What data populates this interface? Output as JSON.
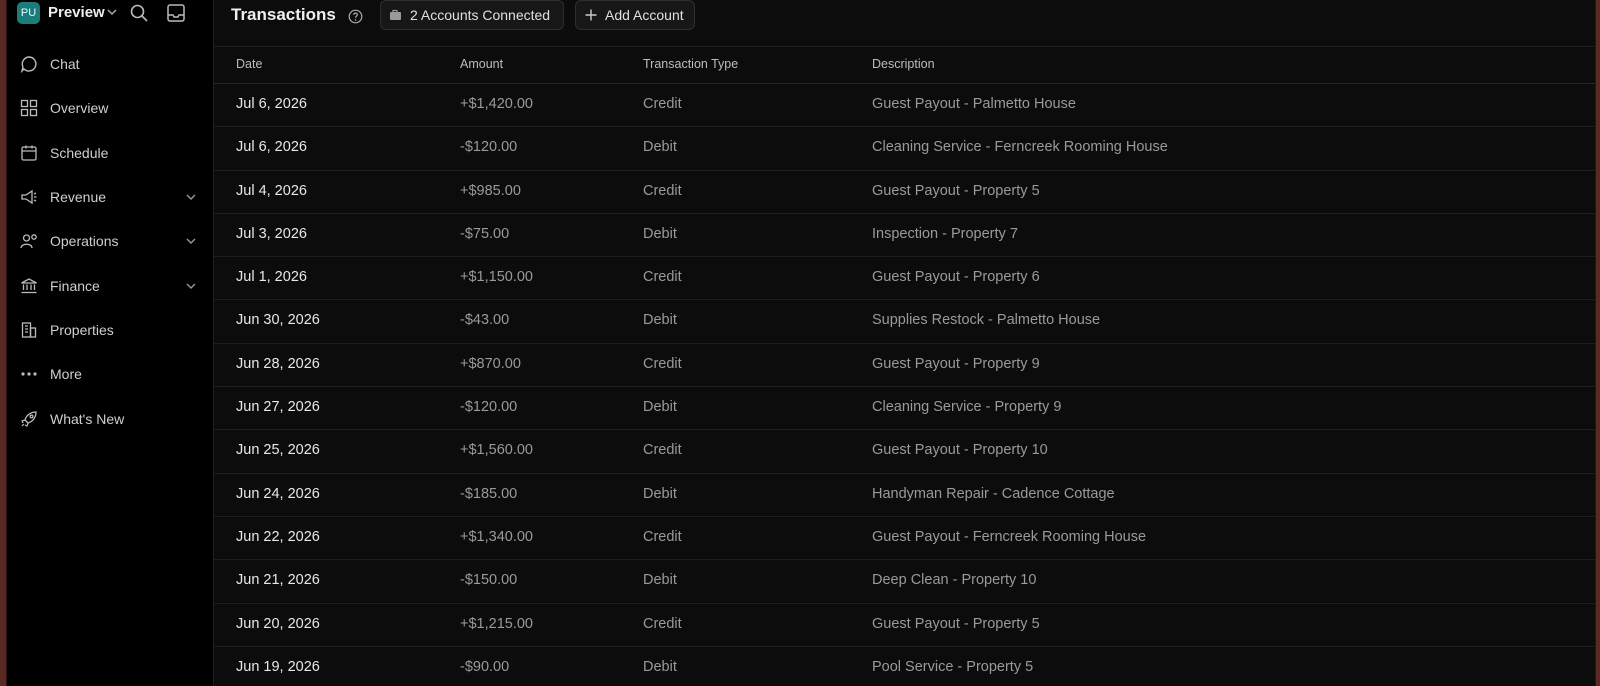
{
  "workspace": {
    "initials": "PU",
    "name": "Preview"
  },
  "sidebar": {
    "items": [
      {
        "label": "Chat",
        "icon": "chat-bubble-icon",
        "expandable": false
      },
      {
        "label": "Overview",
        "icon": "grid-icon",
        "expandable": false
      },
      {
        "label": "Schedule",
        "icon": "calendar-icon",
        "expandable": false
      },
      {
        "label": "Revenue",
        "icon": "megaphone-icon",
        "expandable": true
      },
      {
        "label": "Operations",
        "icon": "users-gear-icon",
        "expandable": true
      },
      {
        "label": "Finance",
        "icon": "bank-icon",
        "expandable": true
      },
      {
        "label": "Properties",
        "icon": "building-icon",
        "expandable": false
      },
      {
        "label": "More",
        "icon": "dots-icon",
        "expandable": false
      },
      {
        "label": "What's New",
        "icon": "rocket-icon",
        "expandable": false
      }
    ]
  },
  "header": {
    "title": "Transactions",
    "accounts_label": "2 Accounts Connected",
    "add_account_label": "Add Account"
  },
  "table": {
    "columns": [
      "Date",
      "Amount",
      "Transaction Type",
      "Description"
    ],
    "rows": [
      [
        "Jul 6, 2026",
        "+$1,420.00",
        "Credit",
        "Guest Payout - Palmetto House"
      ],
      [
        "Jul 6, 2026",
        "-$120.00",
        "Debit",
        "Cleaning Service - Ferncreek Rooming House"
      ],
      [
        "Jul 4, 2026",
        "+$985.00",
        "Credit",
        "Guest Payout - Property 5"
      ],
      [
        "Jul 3, 2026",
        "-$75.00",
        "Debit",
        "Inspection - Property 7"
      ],
      [
        "Jul 1, 2026",
        "+$1,150.00",
        "Credit",
        "Guest Payout - Property 6"
      ],
      [
        "Jun 30, 2026",
        "-$43.00",
        "Debit",
        "Supplies Restock - Palmetto House"
      ],
      [
        "Jun 28, 2026",
        "+$870.00",
        "Credit",
        "Guest Payout - Property 9"
      ],
      [
        "Jun 27, 2026",
        "-$120.00",
        "Debit",
        "Cleaning Service - Property 9"
      ],
      [
        "Jun 25, 2026",
        "+$1,560.00",
        "Credit",
        "Guest Payout - Property 10"
      ],
      [
        "Jun 24, 2026",
        "-$185.00",
        "Debit",
        "Handyman Repair - Cadence Cottage"
      ],
      [
        "Jun 22, 2026",
        "+$1,340.00",
        "Credit",
        "Guest Payout - Ferncreek Rooming House"
      ],
      [
        "Jun 21, 2026",
        "-$150.00",
        "Debit",
        "Deep Clean - Property 10"
      ],
      [
        "Jun 20, 2026",
        "+$1,215.00",
        "Credit",
        "Guest Payout - Property 5"
      ],
      [
        "Jun 19, 2026",
        "-$90.00",
        "Debit",
        "Pool Service - Property 5"
      ]
    ]
  }
}
